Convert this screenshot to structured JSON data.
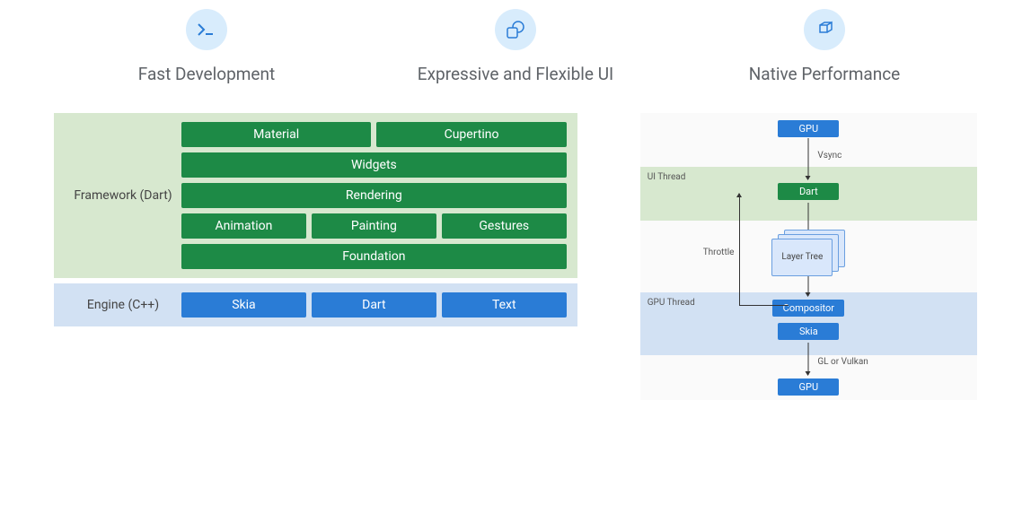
{
  "features": [
    {
      "title": "Fast Development",
      "icon": "terminal"
    },
    {
      "title": "Expressive and Flexible UI",
      "icon": "shapes"
    },
    {
      "title": "Native Performance",
      "icon": "cube"
    }
  ],
  "architecture": {
    "framework": {
      "label": "Framework (Dart)",
      "rows": [
        [
          "Material",
          "Cupertino"
        ],
        [
          "Widgets"
        ],
        [
          "Rendering"
        ],
        [
          "Animation",
          "Painting",
          "Gestures"
        ],
        [
          "Foundation"
        ]
      ]
    },
    "engine": {
      "label": "Engine (C++)",
      "rows": [
        [
          "Skia",
          "Dart",
          "Text"
        ]
      ]
    }
  },
  "pipeline": {
    "ui_thread_label": "UI Thread",
    "gpu_thread_label": "GPU Thread",
    "gpu_top": "GPU",
    "dart": "Dart",
    "layer_tree": "Layer Tree",
    "compositor": "Compositor",
    "skia": "Skia",
    "gpu_bottom": "GPU",
    "vsync": "Vsync",
    "gl_vulkan": "GL or Vulkan",
    "throttle": "Throttle"
  }
}
